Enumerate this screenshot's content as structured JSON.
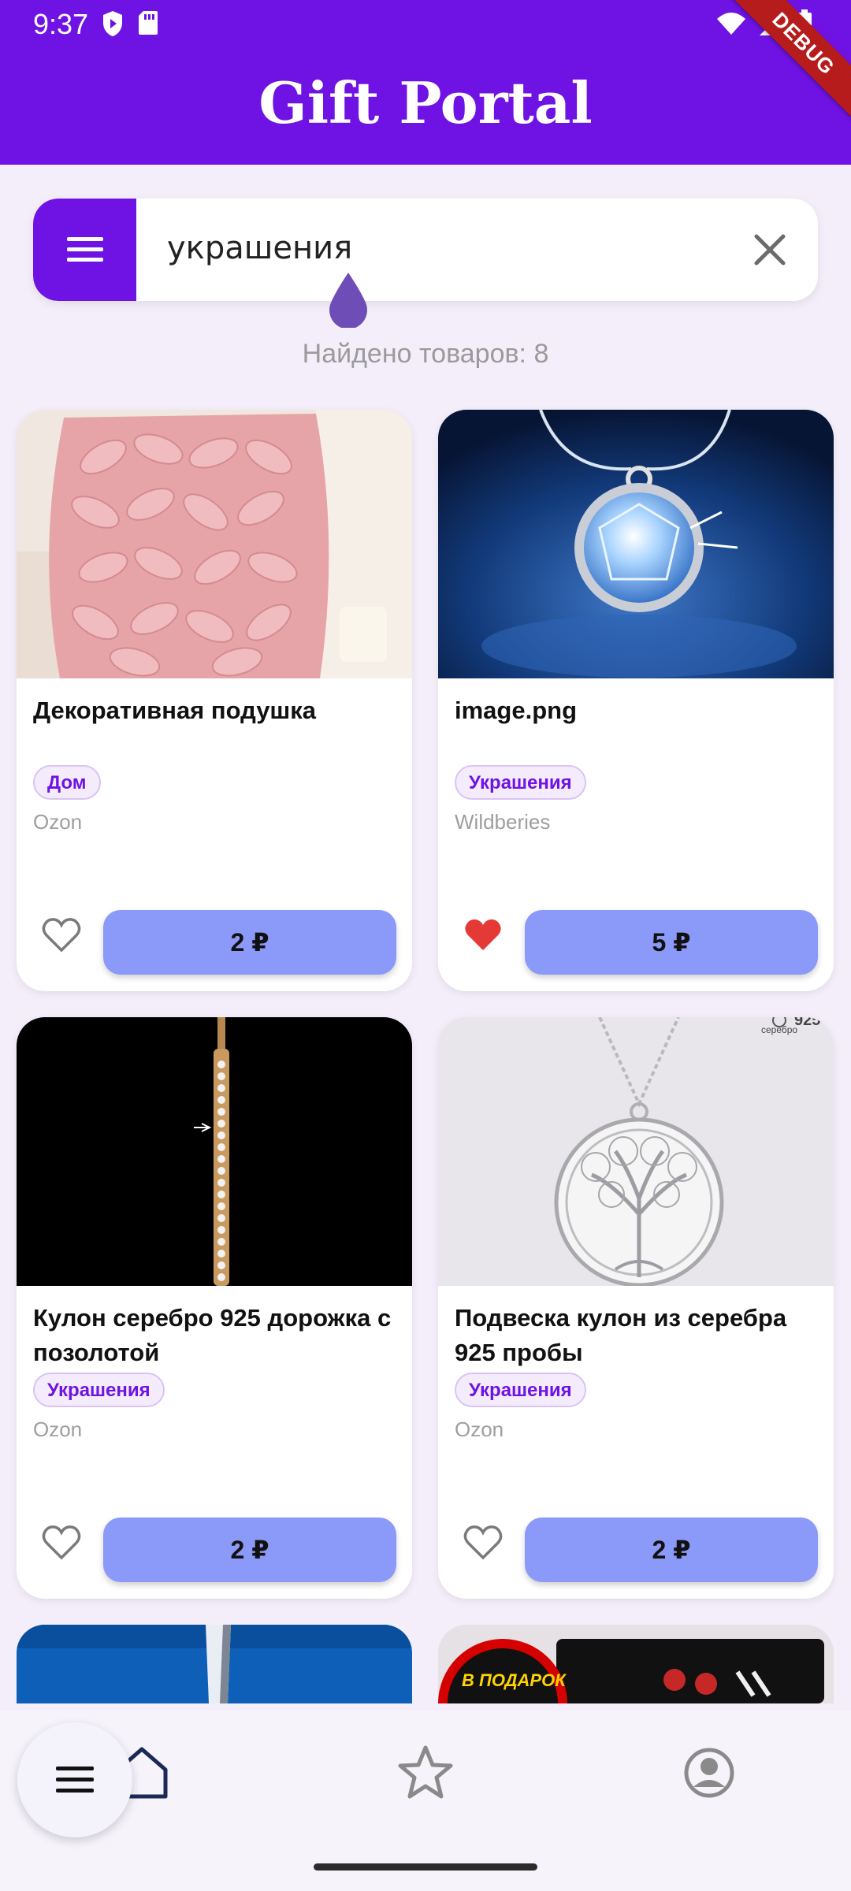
{
  "status_bar": {
    "time": "9:37",
    "debug_label": "DEBUG"
  },
  "app": {
    "title": "Gift Portal"
  },
  "search": {
    "value": "украшения",
    "results_label": "Найдено товаров: 8"
  },
  "products": [
    {
      "title": "Декоративная подушка",
      "category": "Дом",
      "store": "Ozon",
      "price": "2 ₽",
      "favorite": false
    },
    {
      "title": "image.png",
      "category": "Украшения",
      "store": "Wildberies",
      "price": "5 ₽",
      "favorite": true
    },
    {
      "title": "Кулон серебро 925 дорожка с позолотой",
      "category": "Украшения",
      "store": "Ozon",
      "price": "2 ₽",
      "favorite": false
    },
    {
      "title": "Подвеска кулон из серебра 925 пробы",
      "category": "Украшения",
      "store": "Ozon",
      "price": "2 ₽",
      "favorite": false
    }
  ],
  "product_images": {
    "pendant_tag": "925",
    "pendant_tag_sub": "серебро",
    "promo_badge": "В ПОДАРОК"
  },
  "colors": {
    "primary": "#6f12e4",
    "price_button": "#8b99f8",
    "favorite_active": "#e53935"
  },
  "bottom_nav": {
    "items": [
      "home-icon",
      "star-icon",
      "profile-icon"
    ],
    "fab_icon": "menu-icon"
  }
}
